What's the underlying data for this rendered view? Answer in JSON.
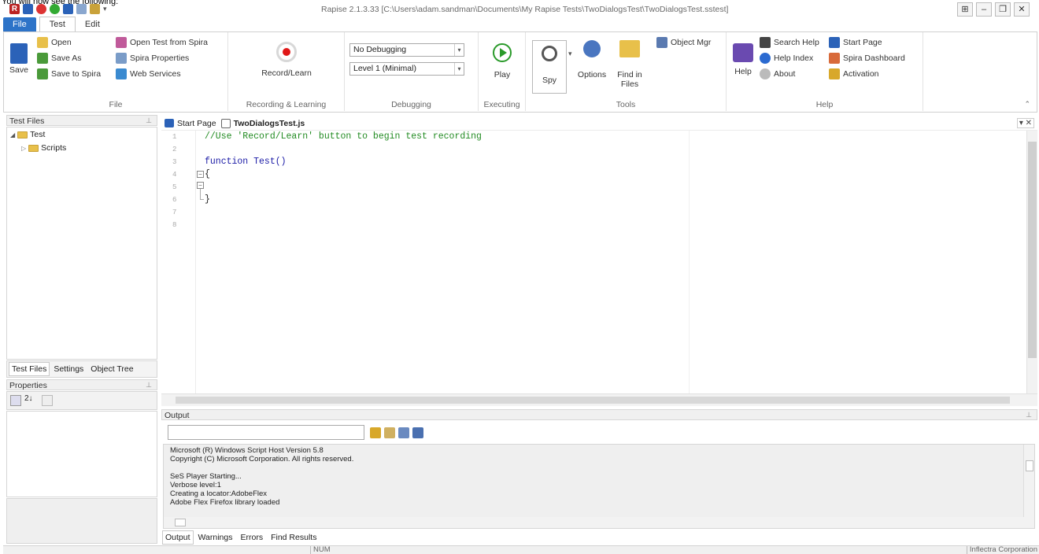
{
  "caption": "You will now see the following:",
  "window": {
    "title": "Rapise 2.1.3.33 [C:\\Users\\adam.sandman\\Documents\\My Rapise Tests\\TwoDialogsTest\\TwoDialogsTest.sstest]",
    "buttons": [
      "⊞",
      "–",
      "❐",
      "✕"
    ]
  },
  "ribbon_tabs": [
    "File",
    "Test",
    "Edit"
  ],
  "ribbon": {
    "file_group": {
      "label": "File",
      "save": "Save",
      "open": "Open",
      "save_as": "Save As",
      "save_to_spira": "Save to Spira",
      "open_from_spira": "Open Test from Spira",
      "spira_properties": "Spira Properties",
      "web_services": "Web Services"
    },
    "recording_group": {
      "label": "Recording & Learning",
      "record_learn": "Record/Learn"
    },
    "debugging_group": {
      "label": "Debugging",
      "debug_mode": "No Debugging",
      "verbosity": "Level 1 (Minimal)"
    },
    "executing_group": {
      "label": "Executing",
      "play": "Play"
    },
    "tools_group": {
      "label": "Tools",
      "spy": "Spy",
      "options": "Options",
      "find_in_files_1": "Find in",
      "find_in_files_2": "Files",
      "object_mgr": "Object Mgr"
    },
    "help_group": {
      "label": "Help",
      "help": "Help",
      "search_help": "Search Help",
      "help_index": "Help Index",
      "about": "About",
      "start_page": "Start Page",
      "spira_dashboard": "Spira Dashboard",
      "activation": "Activation"
    }
  },
  "test_files_panel": {
    "title": "Test Files",
    "tree": {
      "root": "Test",
      "child": "Scripts"
    },
    "tabs": [
      "Test Files",
      "Settings",
      "Object Tree"
    ]
  },
  "properties_panel": {
    "title": "Properties"
  },
  "editor": {
    "tabs": [
      "Start Page",
      "TwoDialogsTest.js"
    ],
    "line_numbers": [
      "1",
      "2",
      "3",
      "4",
      "5",
      "6",
      "7",
      "8"
    ],
    "lines": [
      "//Use 'Record/Learn' button to begin test recording",
      "",
      "function Test()",
      "{",
      "",
      "}"
    ]
  },
  "output_panel": {
    "title": "Output",
    "log": [
      "Microsoft (R) Windows Script Host Version 5.8",
      "Copyright (C) Microsoft Corporation. All rights reserved.",
      "",
      "SeS Player Starting...",
      "Verbose level:1",
      "Creating a locator:AdobeFlex",
      "Adobe Flex Firefox library loaded"
    ],
    "tabs": [
      "Output",
      "Warnings",
      "Errors",
      "Find Results"
    ]
  },
  "statusbar": {
    "num": "NUM",
    "company": "Inflectra Corporation"
  },
  "colors": {
    "file_tab": "#2d73c8",
    "comment": "#228b22",
    "keyword": "#1a1aa6"
  }
}
